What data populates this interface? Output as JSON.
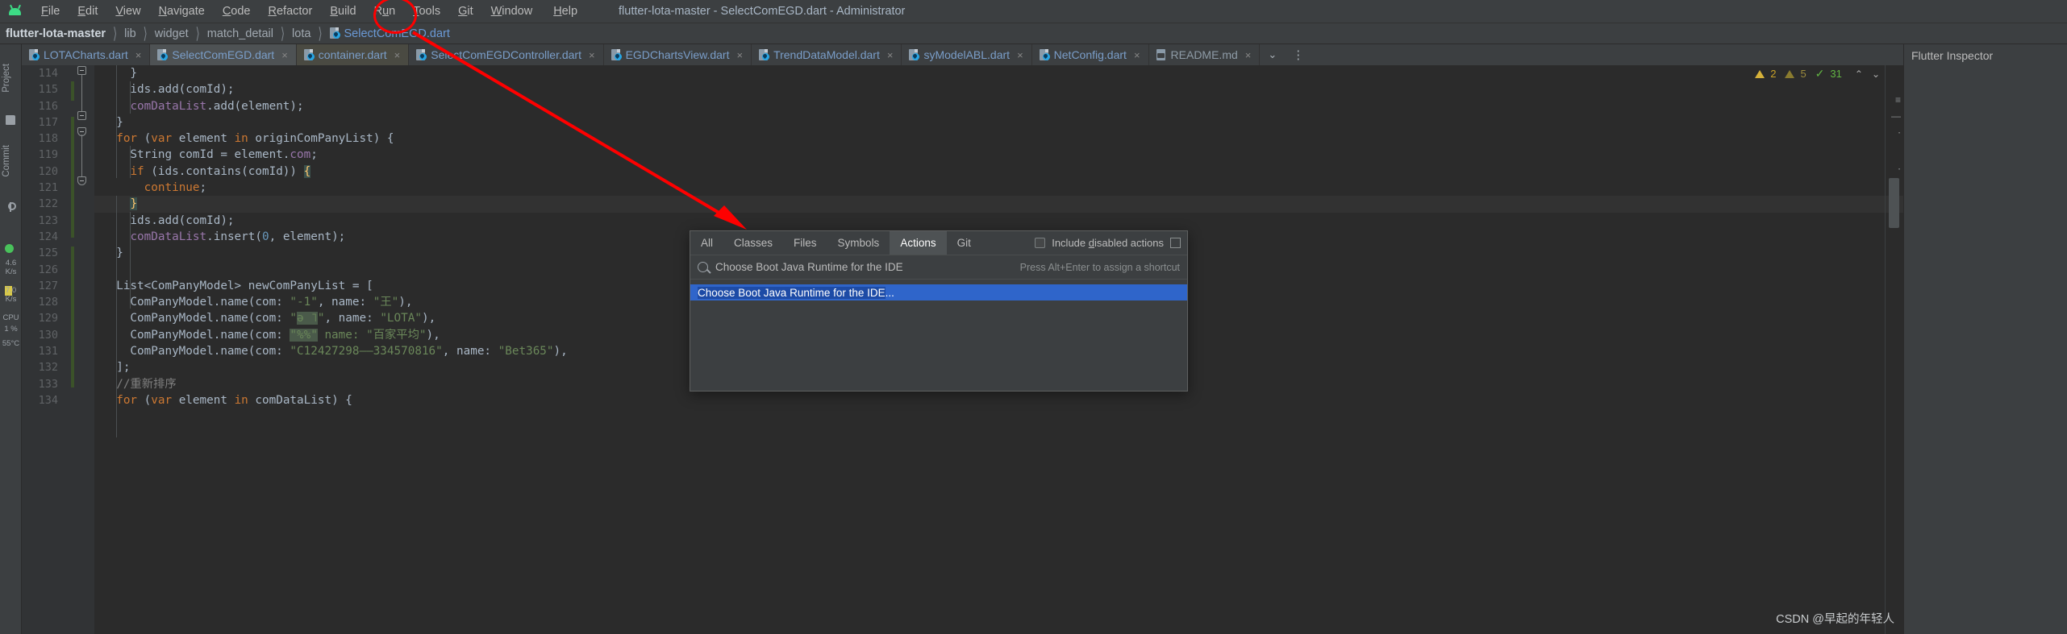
{
  "window": {
    "title": "flutter-lota-master - SelectComEGD.dart - Administrator"
  },
  "menubar": {
    "logo_icon": "android-studio-logo-icon",
    "items": [
      {
        "label": "File",
        "mnemonic": "F"
      },
      {
        "label": "Edit",
        "mnemonic": "E"
      },
      {
        "label": "View",
        "mnemonic": "V"
      },
      {
        "label": "Navigate",
        "mnemonic": "N"
      },
      {
        "label": "Code",
        "mnemonic": "C"
      },
      {
        "label": "Refactor",
        "mnemonic": "R"
      },
      {
        "label": "Build",
        "mnemonic": "B"
      },
      {
        "label": "Run",
        "mnemonic": "u"
      },
      {
        "label": "Tools",
        "mnemonic": "T"
      },
      {
        "label": "Git",
        "mnemonic": "G"
      },
      {
        "label": "Window",
        "mnemonic": "W"
      },
      {
        "label": "Help",
        "mnemonic": "H"
      }
    ]
  },
  "breadcrumb": {
    "separator": "〉",
    "items": [
      {
        "label": "flutter-lota-master",
        "kind": "root"
      },
      {
        "label": "lib",
        "kind": "dir"
      },
      {
        "label": "widget",
        "kind": "dir"
      },
      {
        "label": "match_detail",
        "kind": "dir"
      },
      {
        "label": "lota",
        "kind": "dir"
      },
      {
        "label": "SelectComEGD.dart",
        "kind": "file",
        "icon": "dart-file-icon"
      }
    ]
  },
  "editor_tabs": {
    "close_glyph": "×",
    "overflow_glyph": "⌄",
    "more_glyph": "⋮",
    "items": [
      {
        "label": "LOTACharts.dart",
        "icon": "dart-file-icon",
        "state": "normal"
      },
      {
        "label": "SelectComEGD.dart",
        "icon": "dart-file-icon",
        "state": "active"
      },
      {
        "label": "container.dart",
        "icon": "dart-file-icon",
        "state": "pinned"
      },
      {
        "label": "SelectComEGDController.dart",
        "icon": "dart-file-icon",
        "state": "normal"
      },
      {
        "label": "EGDChartsView.dart",
        "icon": "dart-file-icon",
        "state": "normal"
      },
      {
        "label": "TrendDataModel.dart",
        "icon": "dart-file-icon",
        "state": "normal"
      },
      {
        "label": "syModelABL.dart",
        "icon": "dart-file-icon",
        "state": "normal"
      },
      {
        "label": "NetConfig.dart",
        "icon": "dart-file-icon",
        "state": "normal"
      },
      {
        "label": "README.md",
        "icon": "markdown-file-icon",
        "state": "normal"
      }
    ]
  },
  "right_panel": {
    "title": "Flutter Inspector"
  },
  "left_strip": {
    "project_label": "Project",
    "commit_label": "Commit",
    "folder_icon": "folder-icon",
    "branch_icon": "git-branch-icon",
    "run_indicator_icon": "green-run-dot-icon",
    "stats": [
      {
        "line1": "4.6",
        "line2": "K/s"
      },
      {
        "line1": "7.0",
        "line2": "K/s"
      },
      {
        "line1": "CPU",
        "line2": ""
      },
      {
        "line1": "1 %",
        "line2": ""
      },
      {
        "line1": "55°C",
        "line2": ""
      }
    ]
  },
  "inspections": {
    "warning_icon": "warning-triangle-icon",
    "warning_count": "2",
    "weak_icon": "weak-warning-triangle-icon",
    "weak_count": "5",
    "ok_icon": "checkmark-icon",
    "ok_count": "31",
    "prev_glyph": "⌃",
    "next_glyph": "⌄"
  },
  "code": {
    "first_line": 114,
    "lines": [
      {
        "n": 114,
        "tokens": [
          {
            "t": "    ",
            "c": "plain"
          },
          {
            "t": "}",
            "c": "plain"
          }
        ]
      },
      {
        "n": 115,
        "tokens": [
          {
            "t": "    ids.",
            "c": "plain"
          },
          {
            "t": "add",
            "c": "plain"
          },
          {
            "t": "(comId);",
            "c": "plain"
          }
        ]
      },
      {
        "n": 116,
        "tokens": [
          {
            "t": "    ",
            "c": "plain"
          },
          {
            "t": "comDataList",
            "c": "fld"
          },
          {
            "t": ".add(element);",
            "c": "plain"
          }
        ]
      },
      {
        "n": 117,
        "tokens": [
          {
            "t": "  }",
            "c": "plain"
          }
        ]
      },
      {
        "n": 118,
        "tokens": [
          {
            "t": "  ",
            "c": "plain"
          },
          {
            "t": "for",
            "c": "kw"
          },
          {
            "t": " (",
            "c": "plain"
          },
          {
            "t": "var",
            "c": "kw"
          },
          {
            "t": " element ",
            "c": "plain"
          },
          {
            "t": "in",
            "c": "kw"
          },
          {
            "t": " originComPanyList) {",
            "c": "plain"
          }
        ]
      },
      {
        "n": 119,
        "tokens": [
          {
            "t": "    String comId = element.",
            "c": "plain"
          },
          {
            "t": "com",
            "c": "fld"
          },
          {
            "t": ";",
            "c": "plain"
          }
        ]
      },
      {
        "n": 120,
        "tokens": [
          {
            "t": "    ",
            "c": "plain"
          },
          {
            "t": "if",
            "c": "kw"
          },
          {
            "t": " (ids.contains(comId)) ",
            "c": "plain"
          },
          {
            "t": "{",
            "c": "bracehl"
          }
        ]
      },
      {
        "n": 121,
        "tokens": [
          {
            "t": "      ",
            "c": "plain"
          },
          {
            "t": "continue",
            "c": "kw"
          },
          {
            "t": ";",
            "c": "plain"
          }
        ]
      },
      {
        "n": 122,
        "tokens": [
          {
            "t": "    ",
            "c": "plain"
          },
          {
            "t": "}",
            "c": "bracehl"
          }
        ]
      },
      {
        "n": 123,
        "tokens": [
          {
            "t": "    ids.add(comId);",
            "c": "plain"
          }
        ]
      },
      {
        "n": 124,
        "tokens": [
          {
            "t": "    ",
            "c": "plain"
          },
          {
            "t": "comDataList",
            "c": "fld"
          },
          {
            "t": ".insert(",
            "c": "plain"
          },
          {
            "t": "0",
            "c": "num"
          },
          {
            "t": ", element);",
            "c": "plain"
          }
        ]
      },
      {
        "n": 125,
        "tokens": [
          {
            "t": "  }",
            "c": "plain"
          }
        ]
      },
      {
        "n": 126,
        "tokens": [
          {
            "t": "",
            "c": "plain"
          }
        ]
      },
      {
        "n": 127,
        "tokens": [
          {
            "t": "  List<ComPanyModel> newComPanyList = [",
            "c": "plain"
          }
        ]
      },
      {
        "n": 128,
        "tokens": [
          {
            "t": "    ComPanyModel.name(com: ",
            "c": "plain"
          },
          {
            "t": "\"-1\"",
            "c": "str"
          },
          {
            "t": ", name: ",
            "c": "plain"
          },
          {
            "t": "\"王\"",
            "c": "str"
          },
          {
            "t": "),",
            "c": "plain"
          }
        ]
      },
      {
        "n": 129,
        "tokens": [
          {
            "t": "    ComPanyModel.name(com: ",
            "c": "plain"
          },
          {
            "t": "\"□□\"",
            "c": "str"
          },
          {
            "t": ", name: ",
            "c": "plain"
          },
          {
            "t": "\"LOTA\"",
            "c": "str"
          },
          {
            "t": "),",
            "c": "plain"
          }
        ]
      },
      {
        "n": 130,
        "tokens": [
          {
            "t": "    ComPanyModel.name(com: ",
            "c": "plain"
          },
          {
            "t": "\"□□\"",
            "c": "str"
          },
          {
            "t": ", name: ",
            "c": "plain"
          },
          {
            "t": "\"百家平均\"",
            "c": "str"
          },
          {
            "t": "),",
            "c": "plain"
          }
        ]
      },
      {
        "n": 131,
        "tokens": [
          {
            "t": "    ComPanyModel.name(com: ",
            "c": "plain"
          },
          {
            "t": "\"C12427298——334570816\"",
            "c": "str"
          },
          {
            "t": ", name: ",
            "c": "plain"
          },
          {
            "t": "\"Bet365\"",
            "c": "str"
          },
          {
            "t": "),",
            "c": "plain"
          }
        ]
      },
      {
        "n": 132,
        "tokens": [
          {
            "t": "  ];",
            "c": "plain"
          }
        ]
      },
      {
        "n": 133,
        "tokens": [
          {
            "t": "  ",
            "c": "plain"
          },
          {
            "t": "//重新排序",
            "c": "cmt"
          }
        ]
      },
      {
        "n": 134,
        "tokens": [
          {
            "t": "  ",
            "c": "plain"
          },
          {
            "t": "for",
            "c": "kw"
          },
          {
            "t": " (",
            "c": "plain"
          },
          {
            "t": "var",
            "c": "kw"
          },
          {
            "t": " element ",
            "c": "plain"
          },
          {
            "t": "in",
            "c": "kw"
          },
          {
            "t": " comDataList) {",
            "c": "plain"
          }
        ]
      }
    ]
  },
  "search_everywhere": {
    "tabs": [
      {
        "label": "All",
        "selected": false
      },
      {
        "label": "Classes",
        "selected": false
      },
      {
        "label": "Files",
        "selected": false
      },
      {
        "label": "Symbols",
        "selected": false
      },
      {
        "label": "Actions",
        "selected": true
      },
      {
        "label": "Git",
        "selected": false
      }
    ],
    "checkbox_label_pre": "Include ",
    "checkbox_label_mn": "d",
    "checkbox_label_post": "isabled actions",
    "checkbox_checked": false,
    "checkbox_name": "include-disabled-actions-checkbox",
    "pin_icon": "pin-window-icon",
    "search_icon": "search-icon",
    "query": "Choose Boot Java Runtime for the IDE",
    "hint": "Press Alt+Enter to assign a shortcut",
    "results": [
      {
        "label": "Choose Boot Java Runtime for the IDE",
        "suffix": "...",
        "selected": true
      }
    ]
  },
  "annotations": {
    "ellipse_target": "help-menu-highlight",
    "arrow": "red-arrow-to-search-popup",
    "accent_color": "#fe0000"
  },
  "watermark": {
    "text": "CSDN @早起的年轻人"
  }
}
